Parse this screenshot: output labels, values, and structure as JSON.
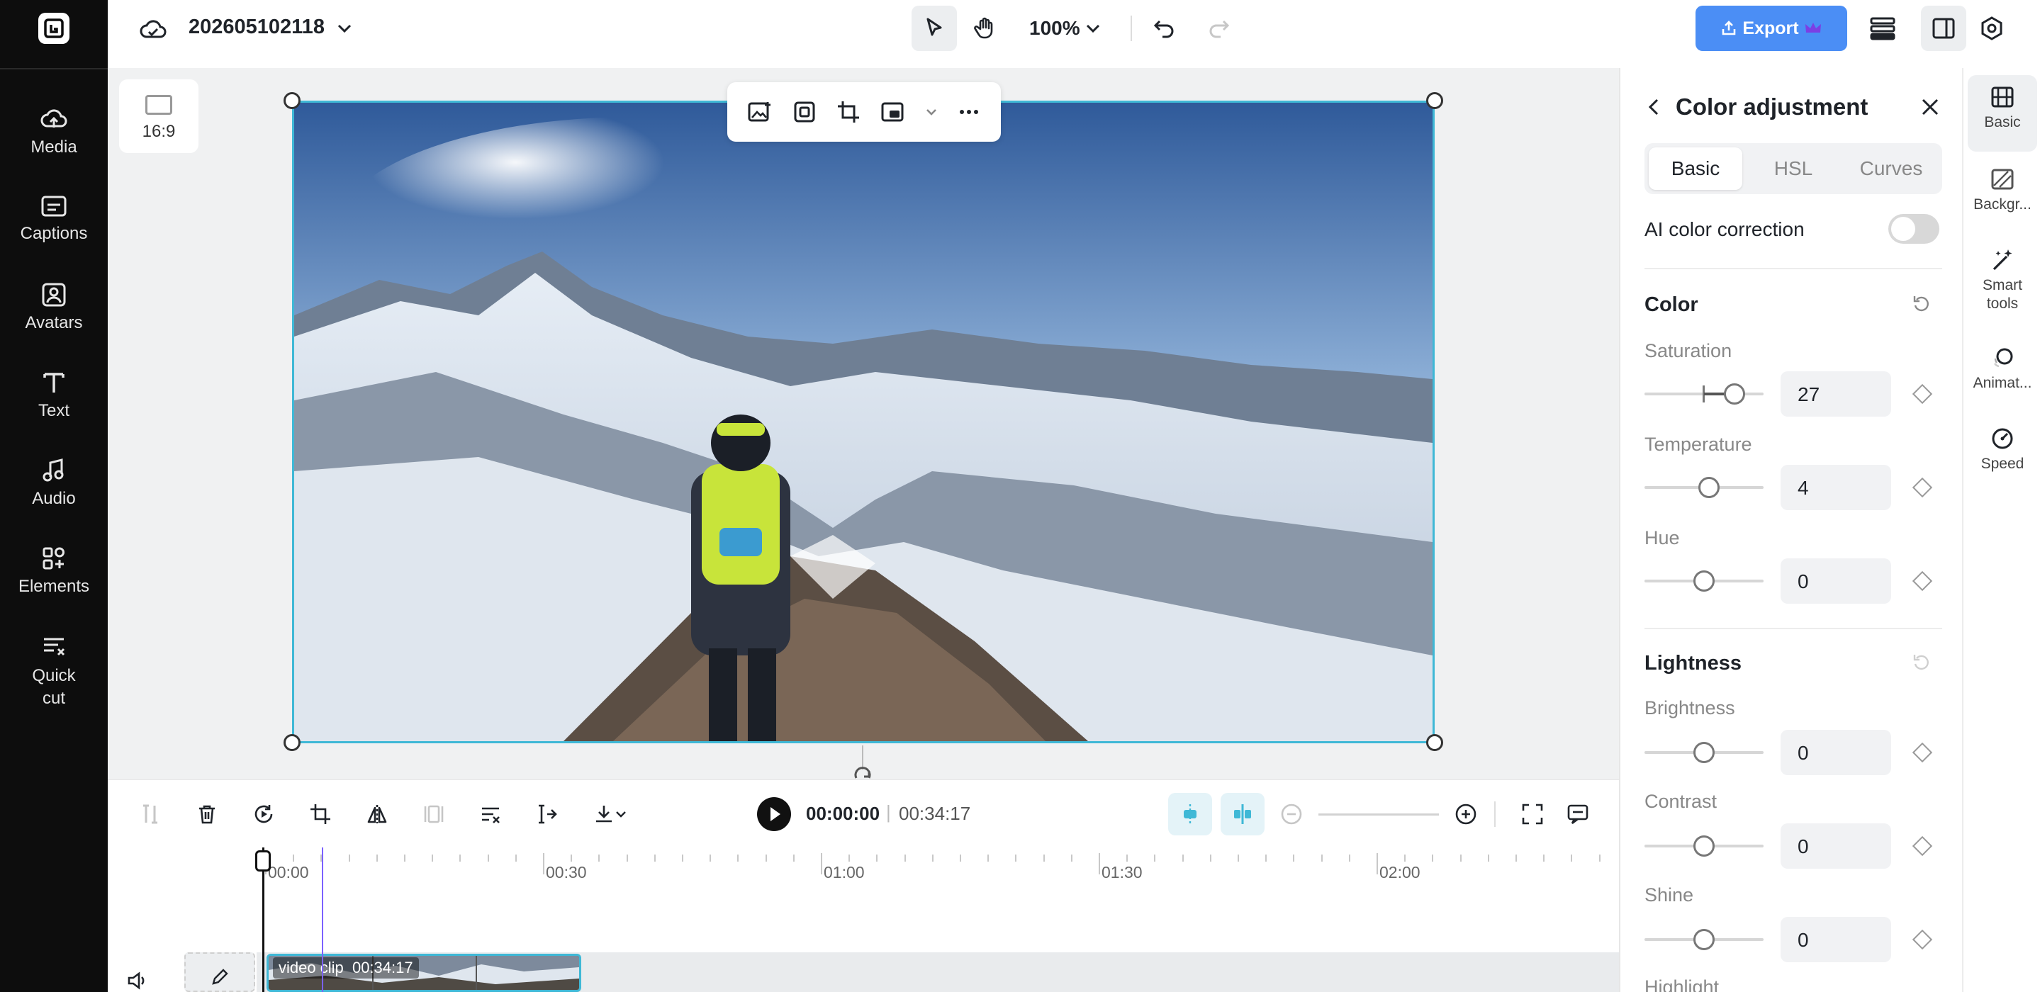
{
  "project": {
    "name": "202605102118"
  },
  "toolbar": {
    "zoom": "100%",
    "export_label": "Export"
  },
  "left_nav": [
    {
      "label": "Media",
      "icon": "cloud-upload-icon"
    },
    {
      "label": "Captions",
      "icon": "captions-icon"
    },
    {
      "label": "Avatars",
      "icon": "avatar-icon"
    },
    {
      "label": "Text",
      "icon": "text-icon"
    },
    {
      "label": "Audio",
      "icon": "music-icon"
    },
    {
      "label": "Elements",
      "icon": "elements-icon"
    },
    {
      "label": "Quick cut",
      "icon": "quick-cut-icon"
    }
  ],
  "canvas": {
    "aspect_ratio": "16:9"
  },
  "playback": {
    "current_time": "00:00:00",
    "separator": "|",
    "total_time": "00:34:17"
  },
  "timeline": {
    "ruler": [
      "00:00",
      "00:30",
      "01:00",
      "01:30",
      "02:00"
    ],
    "clip": {
      "label": "video clip",
      "duration": "00:34:17"
    }
  },
  "panel": {
    "title": "Color adjustment",
    "tabs": [
      {
        "label": "Basic",
        "active": true
      },
      {
        "label": "HSL",
        "active": false
      },
      {
        "label": "Curves",
        "active": false
      }
    ],
    "ai_color_correction": {
      "label": "AI color correction",
      "enabled": false
    },
    "color": {
      "title": "Color",
      "saturation": {
        "label": "Saturation",
        "value": "27"
      },
      "temperature": {
        "label": "Temperature",
        "value": "4"
      },
      "hue": {
        "label": "Hue",
        "value": "0"
      }
    },
    "lightness": {
      "title": "Lightness",
      "brightness": {
        "label": "Brightness",
        "value": "0"
      },
      "contrast": {
        "label": "Contrast",
        "value": "0"
      },
      "shine": {
        "label": "Shine",
        "value": "0"
      },
      "highlight": {
        "label": "Highlight"
      }
    }
  },
  "rail": [
    {
      "label": "Basic",
      "active": true
    },
    {
      "label": "Backgr...",
      "active": false
    },
    {
      "label": "Smart tools",
      "active": false
    },
    {
      "label": "Animat...",
      "active": false
    },
    {
      "label": "Speed",
      "active": false
    }
  ],
  "colors": {
    "accent": "#4b8ef5",
    "selection": "#3fb8d6",
    "sidebar": "#0d0d0d"
  }
}
